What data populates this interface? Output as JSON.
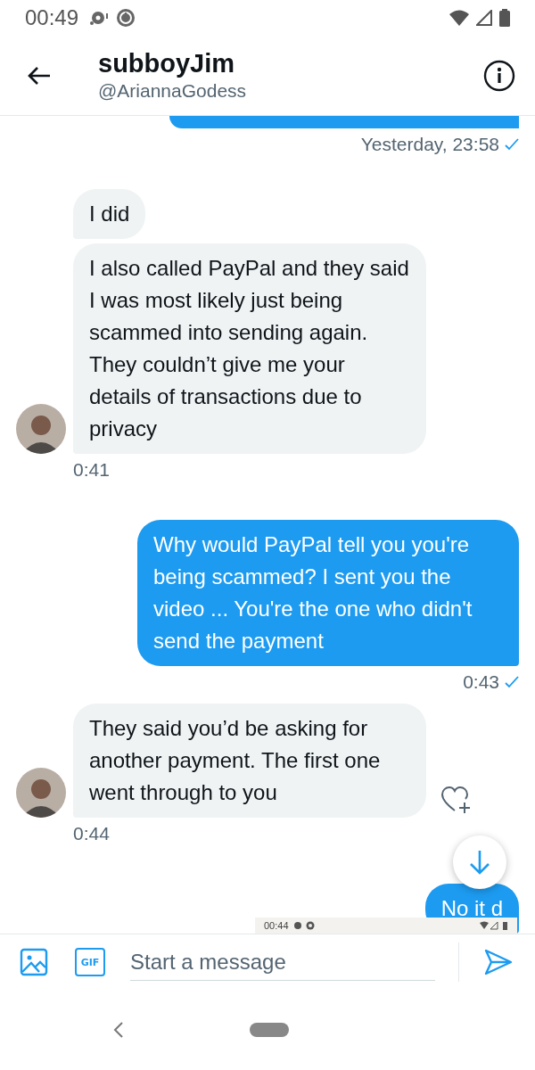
{
  "status_bar": {
    "time": "00:49"
  },
  "header": {
    "name": "subboyJim",
    "handle": "@AriannaGodess"
  },
  "messages": [
    {
      "kind": "sent",
      "time": "Yesterday, 23:58",
      "read": true
    },
    {
      "kind": "received",
      "text": "I did",
      "avatar": false
    },
    {
      "kind": "received",
      "text": "I also called PayPal and they said I was most likely just being scammed into sending again. They couldn’t give me your details of transactions due to privacy",
      "avatar": true,
      "time": "0:41"
    },
    {
      "kind": "sent",
      "text": "Why would PayPal tell you you're being scammed? I sent you the video ... You're the one who didn't send the payment",
      "time": "0:43",
      "read": true
    },
    {
      "kind": "received",
      "text": "They said you’d be asking for another payment. The first one went through to you",
      "avatar": true,
      "react": true,
      "time": "0:44"
    },
    {
      "kind": "sent",
      "text": "No it d"
    }
  ],
  "screenshot_preview": {
    "time": "00:44"
  },
  "composer": {
    "gif_label": "GIF",
    "placeholder": "Start a message"
  }
}
